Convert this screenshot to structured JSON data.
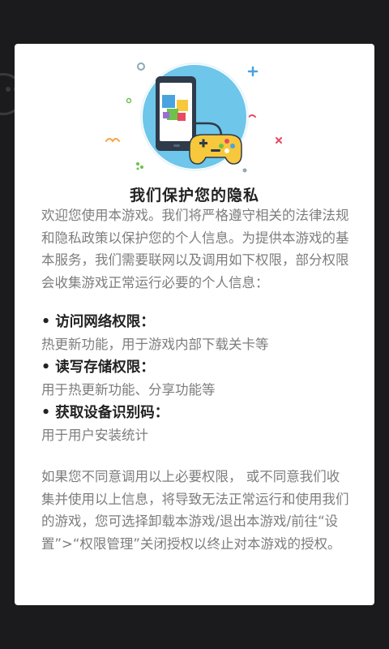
{
  "dialog": {
    "title": "我们保护您的隐私",
    "intro": "欢迎您使用本游戏。我们将严格遵守相关的法律法规和隐私政策以保护您的个人信息。为提供本游戏的基本服务，我们需要联网以及调用如下权限，部分权限会收集游戏正常运行必要的个人信息：",
    "permissions": [
      {
        "title": "• 访问网络权限：",
        "desc": "热更新功能，用于游戏内部下载关卡等"
      },
      {
        "title": "• 读写存储权限：",
        "desc": "用于热更新功能、分享功能等"
      },
      {
        "title": "• 获取设备识别码：",
        "desc": "用于用户安装统计"
      }
    ],
    "closing": "如果您不同意调用以上必要权限， 或不同意我们收集并使用以上信息，将导致无法正常运行和使用我们的游戏，您可选择卸载本游戏/退出本游戏/前往“设置”>“权限管理”关闭授权以终止对本游戏的授权。"
  },
  "illustration": {
    "icon": "phone-gamepad-icon",
    "colors": {
      "circle": "#6ec6ea",
      "phone": "#2f3a4a",
      "gamepad": "#f7c83c",
      "accent_red": "#e84a5f",
      "accent_blue": "#4aa3df",
      "accent_green": "#6cc24a"
    }
  },
  "colors": {
    "overlay": "#1b1b1d",
    "dialog_bg": "#ffffff",
    "title_text": "#222222",
    "body_text": "#7d7d7d"
  }
}
